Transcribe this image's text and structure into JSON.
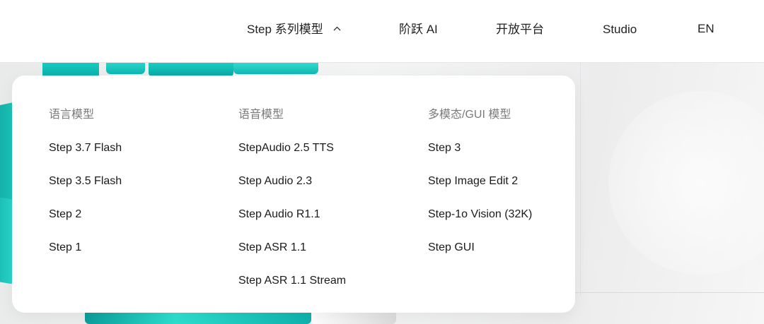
{
  "nav": {
    "models": "Step 系列模型",
    "ai": "阶跃 AI",
    "platform": "开放平台",
    "studio": "Studio",
    "lang": "EN"
  },
  "icons": {
    "models_chevron": "chevron-up-icon"
  },
  "dropdown": {
    "language": {
      "title": "语言模型",
      "items": [
        "Step 3.7 Flash",
        "Step 3.5 Flash",
        "Step 2",
        "Step 1"
      ]
    },
    "audio": {
      "title": "语音模型",
      "items": [
        "StepAudio 2.5 TTS",
        "Step Audio 2.3",
        "Step Audio R1.1",
        "Step ASR 1.1",
        "Step ASR 1.1 Stream"
      ]
    },
    "multimodal": {
      "title": "多模态/GUI 模型",
      "items": [
        "Step 3",
        "Step Image Edit 2",
        "Step-1o Vision (32K)",
        "Step GUI"
      ]
    }
  },
  "colors": {
    "accent_teal": "#1fd9c8",
    "text": "#1a1a1a",
    "muted": "#7a7a7a"
  }
}
